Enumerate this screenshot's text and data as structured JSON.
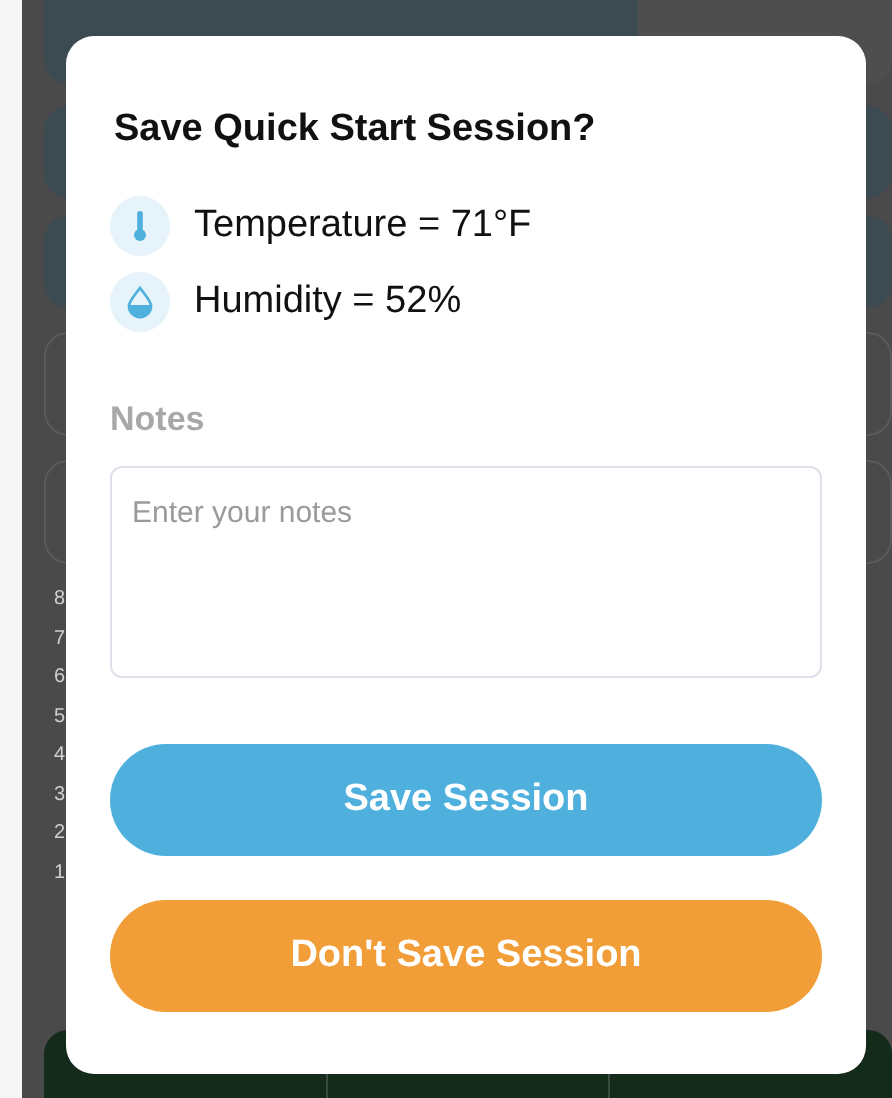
{
  "background": {
    "axis_labels": [
      "8",
      "7",
      "6",
      "5",
      "4",
      "3",
      "2",
      "1"
    ]
  },
  "dialog": {
    "title": "Save Quick Start Session?",
    "readings": [
      {
        "kind": "temperature",
        "text": "Temperature = 71°F"
      },
      {
        "kind": "humidity",
        "text": "Humidity = 52%"
      }
    ],
    "notes": {
      "label": "Notes",
      "placeholder": "Enter your notes"
    },
    "buttons": [
      {
        "kind": "primary",
        "label": "Save Session"
      },
      {
        "kind": "secondary",
        "label": "Don't Save Session"
      }
    ]
  }
}
